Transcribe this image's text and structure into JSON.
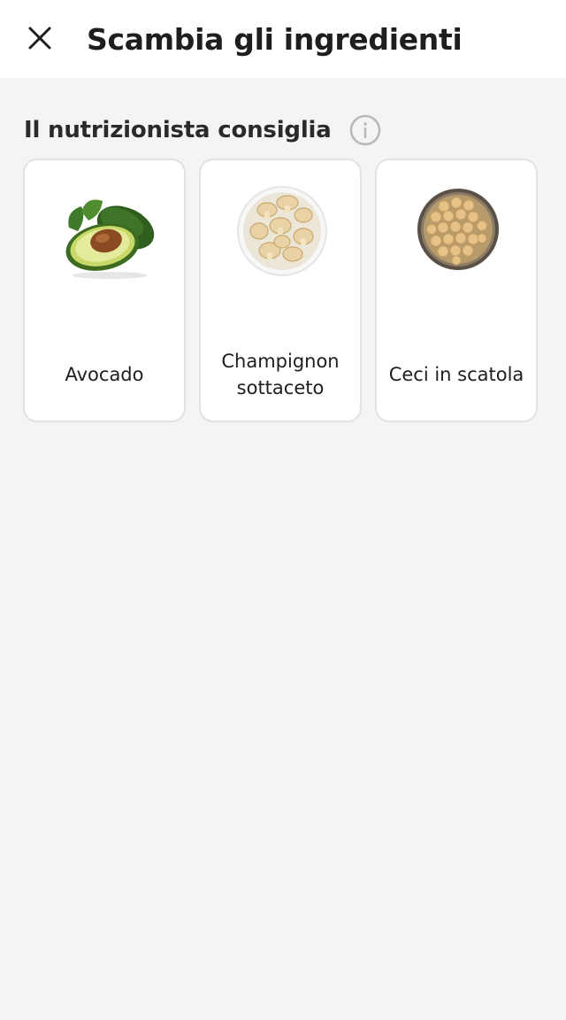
{
  "header": {
    "title": "Scambia gli ingredienti",
    "close_icon": "close-icon"
  },
  "section": {
    "title": "Il nutrizionista consiglia",
    "info_icon": "info-icon"
  },
  "cards": [
    {
      "label": "Avocado",
      "image": "avocado-image"
    },
    {
      "label": "Champignon sottaceto",
      "image": "pickled-mushrooms-image"
    },
    {
      "label": "Ceci in scatola",
      "image": "canned-chickpeas-image"
    }
  ],
  "colors": {
    "background": "#f4f4f4",
    "card_border": "#e2e2e2",
    "text": "#1e1e1e"
  }
}
